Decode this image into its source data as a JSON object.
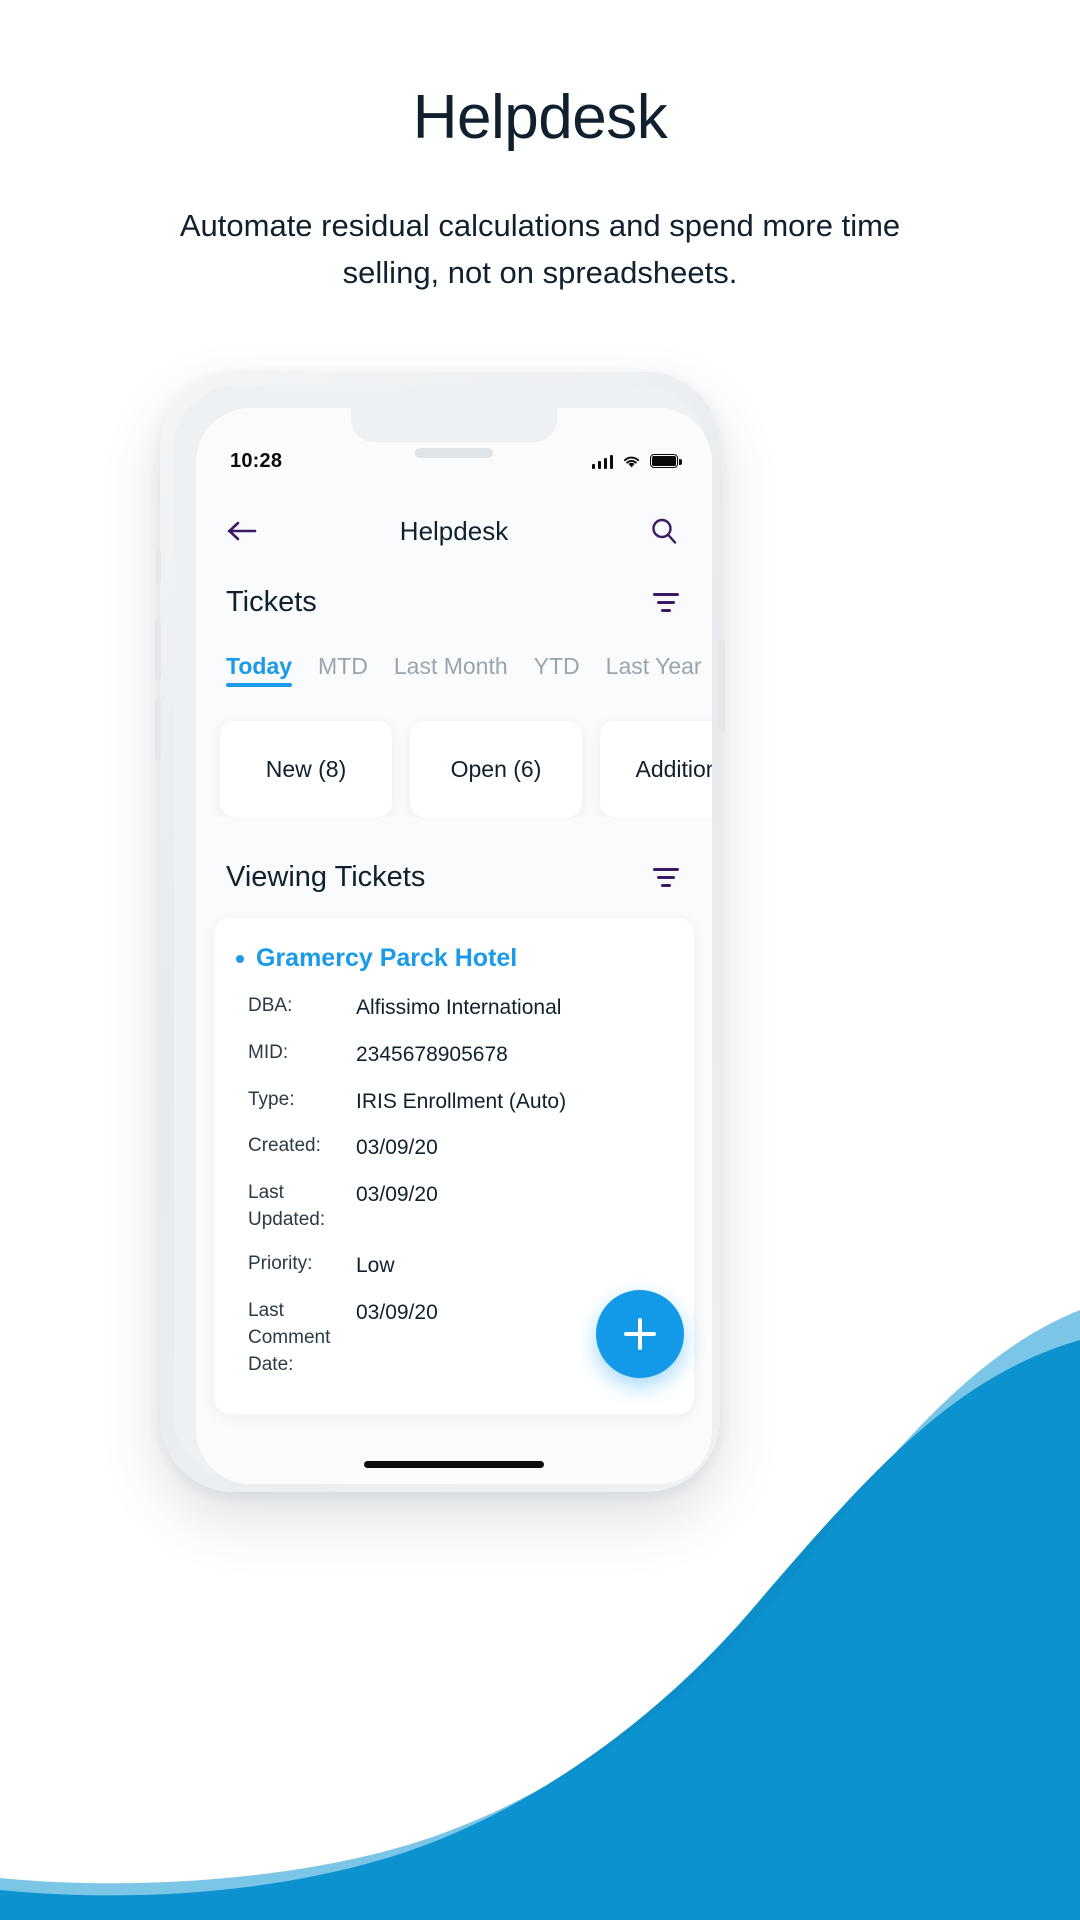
{
  "hero": {
    "title": "Helpdesk",
    "subtitle": "Automate residual calculations and spend more time selling, not on spreadsheets."
  },
  "colors": {
    "accent_blue": "#129ae8",
    "wave_blue": "#0b8ec9",
    "dark_navy": "#10202e",
    "purple_icon": "#3b1a63",
    "muted_gray": "#9aa4ad"
  },
  "phone": {
    "status_bar": {
      "time": "10:28",
      "signal_icon": "cellular-signal-icon",
      "wifi_icon": "wifi-icon",
      "battery_icon": "battery-full-icon"
    },
    "nav": {
      "back_icon": "arrow-left-icon",
      "title": "Helpdesk",
      "search_icon": "search-icon"
    },
    "tickets_section": {
      "title": "Tickets",
      "filter_icon": "filter-icon",
      "tabs": [
        {
          "label": "Today",
          "active": true
        },
        {
          "label": "MTD",
          "active": false
        },
        {
          "label": "Last Month",
          "active": false
        },
        {
          "label": "YTD",
          "active": false
        },
        {
          "label": "Last Year",
          "active": false
        }
      ],
      "stat_cards": [
        {
          "label": "New (8)"
        },
        {
          "label": "Open (6)"
        },
        {
          "label": "Additional"
        }
      ]
    },
    "viewing_section": {
      "title": "Viewing Tickets",
      "filter_icon": "filter-icon",
      "ticket": {
        "name": "Gramercy Parck Hotel",
        "fields": [
          {
            "label": "DBA:",
            "value": "Alfissimo International"
          },
          {
            "label": "MID:",
            "value": "2345678905678"
          },
          {
            "label": "Type:",
            "value": "IRIS Enrollment (Auto)"
          },
          {
            "label": "Created:",
            "value": "03/09/20"
          },
          {
            "label": "Last Updated:",
            "value": "03/09/20"
          },
          {
            "label": "Priority:",
            "value": "Low"
          },
          {
            "label": "Last Comment Date:",
            "value": "03/09/20"
          }
        ]
      }
    },
    "fab": {
      "icon": "plus-icon",
      "label": "+"
    }
  }
}
